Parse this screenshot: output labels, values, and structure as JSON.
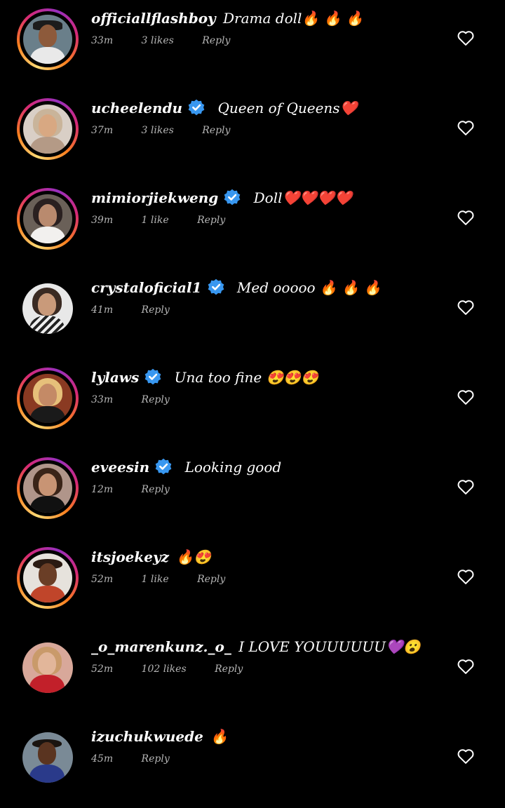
{
  "colors": {
    "background": "#000000",
    "text": "#ffffff",
    "meta": "#b5b5b5",
    "verified": "#3897f0",
    "story_ring": [
      "#feda75",
      "#fa7e1e",
      "#d62976",
      "#962fbf"
    ]
  },
  "comments": [
    {
      "username": "officiallflashboy",
      "verified": false,
      "message": "Drama doll🔥 🔥 🔥",
      "time": "33m",
      "likes": "3 likes",
      "reply": "Reply",
      "story": true,
      "avatar_icon": "avatar-man-cap"
    },
    {
      "username": "ucheelendu",
      "verified": true,
      "message": "Queen of Queens❤️",
      "time": "37m",
      "likes": "3 likes",
      "reply": "Reply",
      "story": true,
      "avatar_icon": "avatar-woman-blonde"
    },
    {
      "username": "mimiorjiekweng",
      "verified": true,
      "message": "Doll❤️❤️❤️❤️",
      "time": "39m",
      "likes": "1 like",
      "reply": "Reply",
      "story": true,
      "avatar_icon": "avatar-woman-white-dress"
    },
    {
      "username": "crystaloficial1",
      "verified": true,
      "message": "Med ooooo 🔥 🔥 🔥",
      "time": "41m",
      "likes": "",
      "reply": "Reply",
      "story": false,
      "avatar_icon": "avatar-woman-striped"
    },
    {
      "username": "lylaws",
      "verified": true,
      "message": "Una too fine 😍😍😍",
      "time": "33m",
      "likes": "",
      "reply": "Reply",
      "story": true,
      "avatar_icon": "avatar-woman-gold"
    },
    {
      "username": "eveesin",
      "verified": true,
      "message": "Looking good",
      "time": "12m",
      "likes": "",
      "reply": "Reply",
      "story": true,
      "avatar_icon": "avatar-woman-black-dress"
    },
    {
      "username": "itsjoekeyz",
      "verified": false,
      "message": "🔥😍",
      "time": "52m",
      "likes": "1 like",
      "reply": "Reply",
      "story": true,
      "avatar_icon": "avatar-man-pointing"
    },
    {
      "username": "_o_marenkunz._o_",
      "verified": false,
      "message": "I LOVE YOUUUUUU💜😮",
      "time": "52m",
      "likes": "102 likes",
      "reply": "Reply",
      "story": false,
      "avatar_icon": "avatar-woman-red"
    },
    {
      "username": "izuchukwuede",
      "verified": false,
      "message": "🔥",
      "time": "45m",
      "likes": "",
      "reply": "Reply",
      "story": false,
      "avatar_icon": "avatar-man-selfie"
    }
  ]
}
